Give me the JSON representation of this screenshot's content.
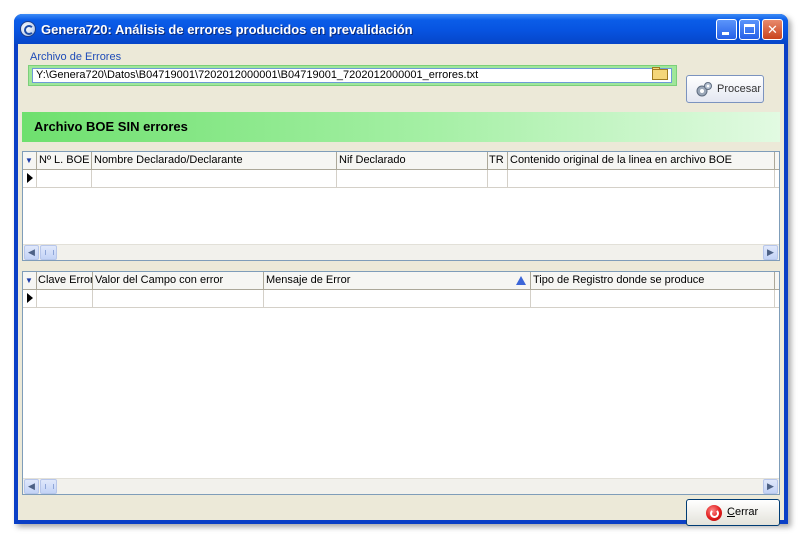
{
  "window": {
    "title": "Genera720: Análisis de errores producidos en prevalidación",
    "controls": {
      "minimize_icon": "minimize-icon",
      "maximize_icon": "maximize-icon",
      "close_icon": "close-icon"
    }
  },
  "file_section": {
    "label": "Archivo de Errores",
    "path": "Y:\\Genera720\\Datos\\B04719001\\7202012000001\\B04719001_7202012000001_errores.txt",
    "browse_icon": "folder-open-icon",
    "process_button": {
      "label": "Procesar",
      "icon": "gears-icon"
    }
  },
  "status": {
    "message": "Archivo BOE SIN errores",
    "colors": {
      "from": "#6ee06e",
      "to": "#e2fae2"
    }
  },
  "records_grid": {
    "columns": [
      "Nº L. BOE",
      "Nombre Declarado/Declarante",
      "Nif Declarado",
      "TR",
      "Contenido original de la linea en archivo BOE"
    ],
    "rows": []
  },
  "errors_grid": {
    "columns": [
      "Clave Error",
      "Valor del Campo con error",
      "Mensaje de Error",
      "Tipo de Registro donde se produce"
    ],
    "rows": []
  },
  "footer": {
    "close_button": {
      "mnemonic": "C",
      "label_rest": "errar",
      "icon": "power-icon"
    }
  },
  "colors": {
    "titlebar": "#0753e0",
    "window_bg": "#ece9d8",
    "label_blue": "#1e4bb8"
  }
}
